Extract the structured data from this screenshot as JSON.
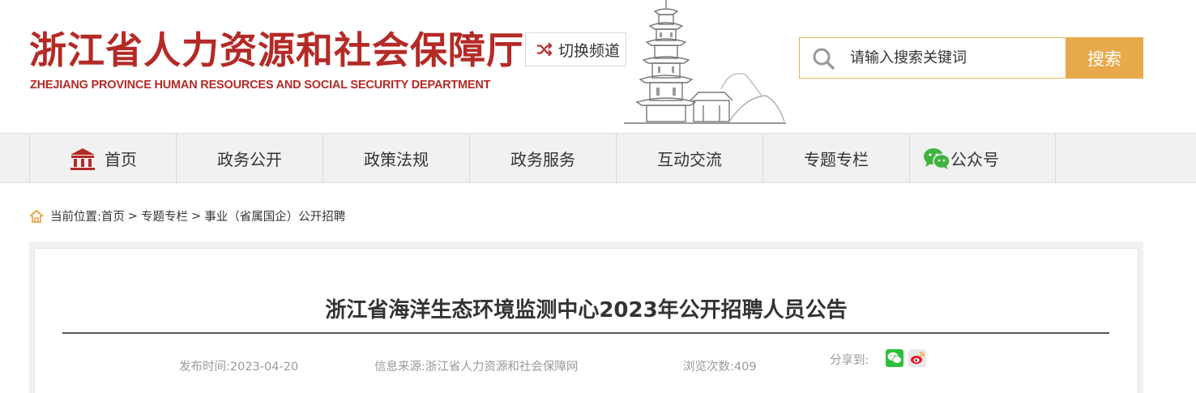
{
  "header": {
    "site_title": "浙江省人力资源和社会保障厅",
    "site_subtitle": "ZHEJIANG PROVINCE HUMAN RESOURCES AND SOCIAL SECURITY DEPARTMENT",
    "switch_channel_label": "切换频道",
    "search": {
      "placeholder": "请输入搜索关键词",
      "button_label": "搜索"
    }
  },
  "nav": {
    "items": [
      {
        "label": "首页",
        "icon": "home-icon"
      },
      {
        "label": "政务公开"
      },
      {
        "label": "政策法规"
      },
      {
        "label": "政务服务"
      },
      {
        "label": "互动交流"
      },
      {
        "label": "专题专栏"
      },
      {
        "label": "公众号",
        "icon": "wechat-icon"
      }
    ]
  },
  "breadcrumb": {
    "prefix": "当前位置:",
    "items": [
      "首页",
      "专题专栏",
      "事业（省属国企）公开招聘"
    ],
    "separator": ">"
  },
  "article": {
    "title": "浙江省海洋生态环境监测中心2023年公开招聘人员公告",
    "publish_time": "发布时间:2023-04-20",
    "source": "信息来源:浙江省人力资源和社会保障网",
    "views": "浏览次数:409",
    "share_label": "分享到:",
    "share_icons": [
      "wechat-share-icon",
      "weibo-share-icon"
    ]
  },
  "colors": {
    "brand_red": "#b42a26",
    "search_button": "#e8a94b",
    "nav_background": "#f1f1f1"
  }
}
